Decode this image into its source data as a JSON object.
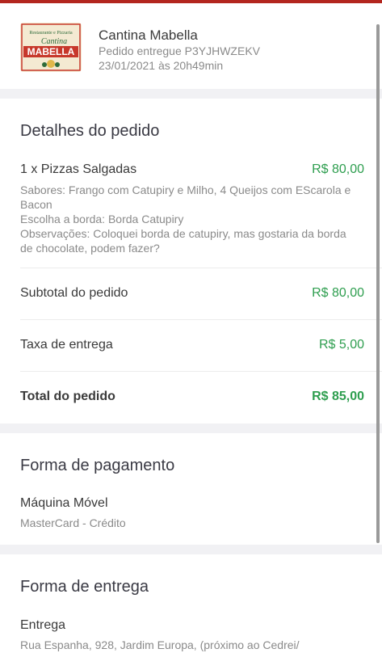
{
  "header": {
    "store_name": "Cantina Mabella",
    "order_status": "Pedido entregue P3YJHWZEKV",
    "order_date": "23/01/2021 às 20h49min",
    "logo": {
      "top_text": "Restaurante e Pizzaria",
      "script_text": "Cantina",
      "main_text": "MABELLA"
    }
  },
  "order_details": {
    "title": "Detalhes do pedido",
    "item": {
      "name": "1 x Pizzas Salgadas",
      "price": "R$ 80,00",
      "flavors": "Sabores: Frango com Catupiry e Milho, 4 Queijos com EScarola e Bacon",
      "crust": "Escolha a borda: Borda Catupiry",
      "notes": "Observações: Coloquei borda de catupiry, mas gostaria da borda de chocolate, podem fazer?"
    },
    "subtotal_label": "Subtotal do pedido",
    "subtotal_value": "R$ 80,00",
    "delivery_fee_label": "Taxa de entrega",
    "delivery_fee_value": "R$ 5,00",
    "total_label": "Total do pedido",
    "total_value": "R$ 85,00"
  },
  "payment": {
    "title": "Forma de pagamento",
    "method": "Máquina Móvel",
    "detail": "MasterCard - Crédito"
  },
  "delivery": {
    "title": "Forma de entrega",
    "method": "Entrega",
    "address": "Rua Espanha, 928, Jardim Europa, (próximo ao Cedrei/"
  },
  "colors": {
    "accent_red": "#b3261e",
    "price_green": "#2e9e4f",
    "separator_gray": "#f1f1f4"
  }
}
